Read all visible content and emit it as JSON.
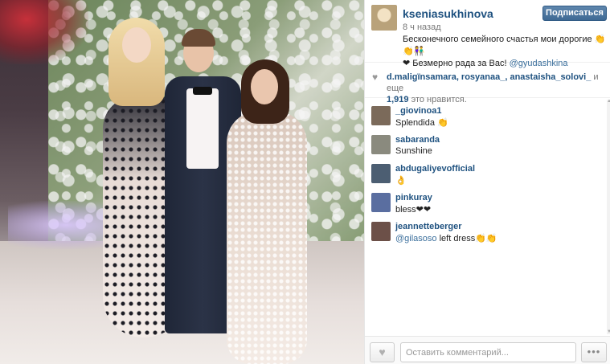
{
  "post": {
    "username": "kseniasukhinova",
    "follow_label": "Подписаться",
    "timestamp": "8 ч назад",
    "caption_text": "Бесконечного семейного счастья мои дорогие 👏👏👫",
    "caption_line2": "❤ Безмерно рада за Вас! ",
    "caption_mention": "@gyudashkina"
  },
  "likes": {
    "heart_icon": "heart-icon",
    "users": "d.maligïnsamara, rosyanaa_, anastaisha_solovi_",
    "joiner": " и еще",
    "count": "1,919",
    "suffix": " это нравится."
  },
  "comments": [
    {
      "user": "_giovinoa1",
      "text": "Splendida 👏",
      "avatar_color": "#7b6a5a"
    },
    {
      "user": "sabaranda",
      "text": "Sunshine",
      "avatar_color": "#8a8a7e"
    },
    {
      "user": "abdugaliyevofficial",
      "text": "👌",
      "avatar_color": "#4c5e72"
    },
    {
      "user": "pinkuray",
      "text": "bless❤❤",
      "avatar_color": "#5a6ea0"
    },
    {
      "user": "jeannetteberger",
      "text_mention": "@gilasoso",
      "text": " left dress👏👏",
      "avatar_color": "#6c5048"
    }
  ],
  "footer": {
    "like_icon": "heart-icon",
    "comment_placeholder": "Оставить комментарий...",
    "more_label": "•••"
  },
  "colors": {
    "username": "#1f5280",
    "follow_button": "#3f6a94",
    "mention": "#3b6f9c"
  }
}
